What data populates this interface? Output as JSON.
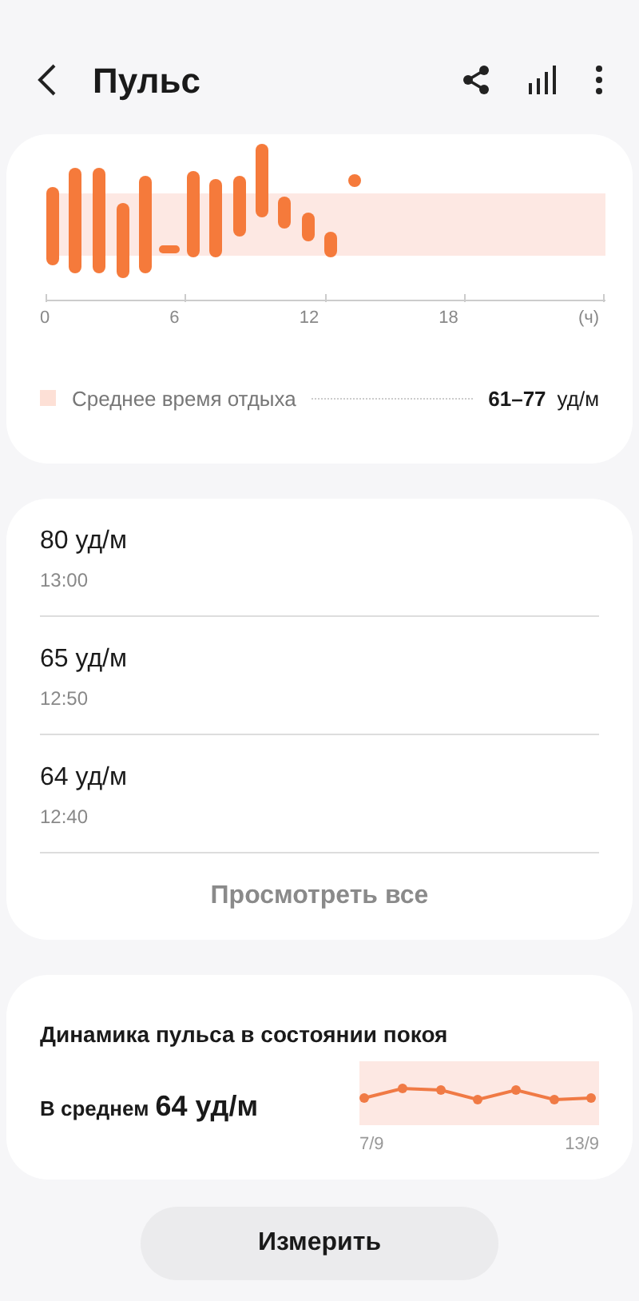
{
  "header": {
    "title": "Пульс"
  },
  "hourly_chart": {
    "x_labels": [
      "0",
      "6",
      "12",
      "18",
      "(ч)"
    ],
    "legend": {
      "label": "Среднее время отдыха",
      "range": "61–77",
      "unit": "уд/м"
    }
  },
  "readings": [
    {
      "value": "80 уд/м",
      "time": "13:00"
    },
    {
      "value": "65 уд/м",
      "time": "12:50"
    },
    {
      "value": "64 уд/м",
      "time": "12:40"
    }
  ],
  "view_all": "Просмотреть все",
  "resting_trend": {
    "title": "Динамика пульса в состоянии покоя",
    "average_label": "В среднем",
    "average_value": "64 уд/м",
    "start_date": "7/9",
    "end_date": "13/9"
  },
  "measure_button": "Измерить"
}
